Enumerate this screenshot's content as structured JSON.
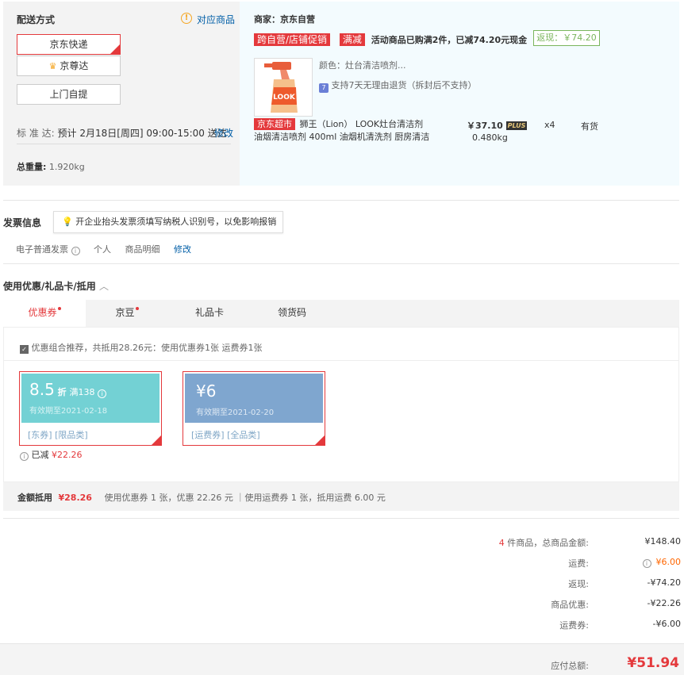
{
  "shipping": {
    "title": "配送方式",
    "supported_goods": "对应商品",
    "options": [
      "京东快递",
      "京尊达",
      "上门自提"
    ],
    "standard_label": "标 准 达:",
    "standard_time": "预计 2月18日[周四] 09:00-15:00 送达",
    "modify": "修改",
    "weight_label": "总重量:",
    "weight_value": "1.920kg"
  },
  "goods": {
    "seller": "商家：京东自营",
    "promo_tag1": "跨自营/店铺促销",
    "promo_tag2": "满减",
    "promo_text": "活动商品已购满2件，已减74.20元现金",
    "cashback": "返现：￥74.20",
    "color": "颜色：灶台清洁喷剂...",
    "return_policy": "支持7天无理由退货（拆封后不支持）",
    "store_tag": "京东超市",
    "name_line1": "狮王（Lion） LOOK灶台清洁剂",
    "name_line2": "油烟清洁喷剂 400ml 油烟机清洗剂 厨房清洁",
    "price": "￥37.10",
    "plus": "PLUS",
    "qty": "x4",
    "stock": "有货",
    "weight": "0.480kg",
    "product_label": "LOOK"
  },
  "invoice": {
    "title": "发票信息",
    "tip": "开企业抬头发票须填写纳税人识别号，以免影响报销",
    "type": "电子普通发票",
    "person": "个人",
    "content": "商品明细",
    "modify": "修改"
  },
  "discount": {
    "title": "使用优惠/礼品卡/抵用",
    "tabs": [
      "优惠券",
      "京豆",
      "礼品卡",
      "领货码"
    ],
    "recommend": "优惠组合推荐，共抵用28.26元：使用优惠券1张 运费券1张",
    "coupons": [
      {
        "main": "8.5",
        "unit": "折",
        "cond": "满138",
        "expiry": "有效期至2021-02-18",
        "tags": "[东券]  [限品类]",
        "color": "#73d1d4"
      },
      {
        "main": "¥6",
        "unit": "",
        "cond": "",
        "expiry": "有效期至2021-02-20",
        "tags": "[运费券]  [全品类]",
        "color": "#7fa6cf"
      }
    ],
    "reduced_label": "已减",
    "reduced_value": "¥22.26",
    "summary_label": "金额抵用",
    "summary_value": "¥28.26",
    "summary_text": "使用优惠券 1 张，优惠 22.26 元 ｜使用运费券 1 张，抵用运费 6.00 元"
  },
  "summary": {
    "count": "4",
    "count_label": "件商品，总商品金额:",
    "total_goods": "¥148.40",
    "freight_label": "运费:",
    "freight": "¥6.00",
    "cashback_label": "返现:",
    "cashback": "-¥74.20",
    "goods_discount_label": "商品优惠:",
    "goods_discount": "-¥22.26",
    "freight_coupon_label": "运费券:",
    "freight_coupon": "-¥6.00",
    "payable_label": "应付总额:",
    "payable": "¥51.94"
  }
}
